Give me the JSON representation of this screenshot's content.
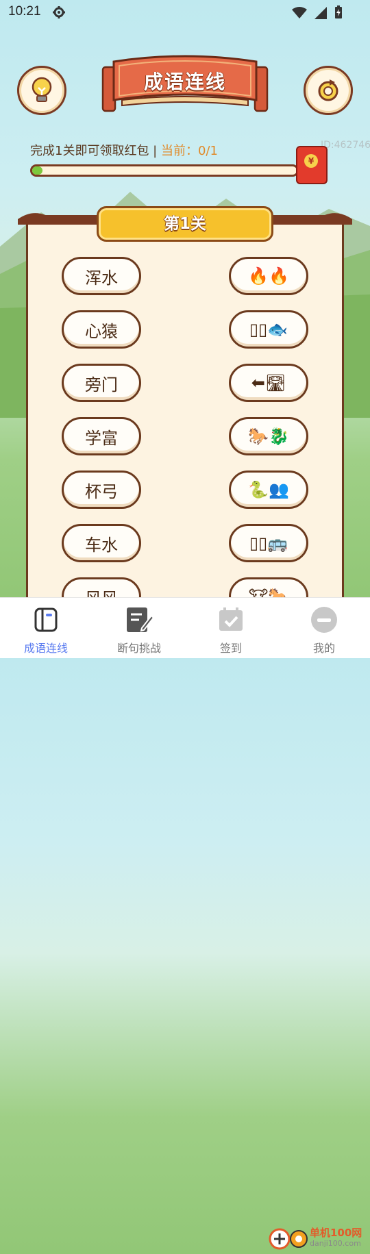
{
  "status_bar": {
    "time": "10:21"
  },
  "header": {
    "title": "成语连线"
  },
  "progress": {
    "label": "完成1关即可领取红包",
    "separator": " | ",
    "current_prefix": "当前：",
    "current_value": "0/1",
    "fill_fraction": 0.04,
    "id_text": "ID:462746",
    "redpacket_symbol": "¥"
  },
  "level": {
    "title": "第1关"
  },
  "left_items": [
    "浑水",
    "心猿",
    "旁门",
    "学富",
    "杯弓",
    "车水",
    "风风"
  ],
  "right_items": [
    "🔥🔥",
    "▯▯🐟",
    "⬅🛣",
    "🐎🐉",
    "🐍👥",
    "▯▯🚌",
    "🐮🐎"
  ],
  "nav": {
    "items": [
      {
        "label": "成语连线",
        "active": true
      },
      {
        "label": "断句挑战",
        "active": false
      },
      {
        "label": "签到",
        "active": false
      },
      {
        "label": "我的",
        "active": false
      }
    ]
  },
  "watermark": {
    "text": "单机100网",
    "url": "danji100.com"
  },
  "colors": {
    "accent": "#5b7cf0",
    "border_brown": "#6b3a1e",
    "progress_green": "#7cc83c",
    "banner_gold": "#f6c12c"
  }
}
